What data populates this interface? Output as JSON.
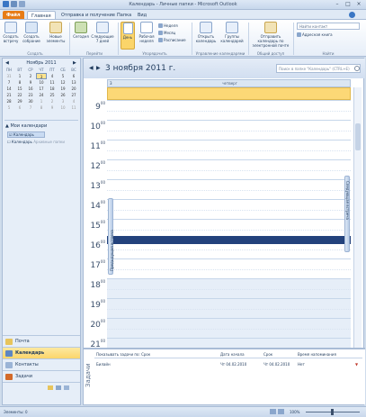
{
  "window": {
    "title": "Календарь - Личные папки - Microsoft Outlook"
  },
  "tabs": [
    "Файл",
    "Главная",
    "Отправка и получение",
    "Папка",
    "Вид"
  ],
  "ribbon": {
    "buttons": {
      "new_meeting_item": "Создать встречу",
      "new_meeting": "Создать собрание",
      "new_items": "Новые элементы",
      "today": "Сегодня",
      "next7": "Следующие 7 дней",
      "day": "День",
      "workweek": "Рабочая неделя",
      "week": "Неделя",
      "month": "Месяц",
      "schedule": "Расписание",
      "open_calendar": "Открыть календарь",
      "calendar_groups": "Группы календарей",
      "send_calendar": "Отправить календарь по электронной почте",
      "find_contact": "Найти контакт",
      "address_book": "Адресная книга"
    },
    "groups": {
      "create": "Создать",
      "goto": "Перейти",
      "arrange": "Упорядочить",
      "manage": "Управление календарями",
      "share": "Общий доступ",
      "find": "Найти"
    }
  },
  "minical": {
    "month": "Ноябрь 2011",
    "weekdays": [
      "ПН",
      "ВТ",
      "СР",
      "ЧТ",
      "ПТ",
      "СБ",
      "ВС"
    ],
    "weeks": [
      [
        "31",
        "1",
        "2",
        "3",
        "4",
        "5",
        "6"
      ],
      [
        "7",
        "8",
        "9",
        "10",
        "11",
        "12",
        "13"
      ],
      [
        "14",
        "15",
        "16",
        "17",
        "18",
        "19",
        "20"
      ],
      [
        "21",
        "22",
        "23",
        "24",
        "25",
        "26",
        "27"
      ],
      [
        "28",
        "29",
        "30",
        "1",
        "2",
        "3",
        "4"
      ],
      [
        "5",
        "6",
        "7",
        "8",
        "9",
        "10",
        "11"
      ]
    ]
  },
  "folders": {
    "header": "Мои календари",
    "item": "Календарь",
    "item2": "Календарь",
    "item2_sub": "Архивные папки"
  },
  "nav": {
    "mail": "Почта",
    "calendar": "Календарь",
    "contacts": "Контакты",
    "tasks": "Задачи"
  },
  "calendar": {
    "date_title": "3 ноября 2011 г.",
    "search_placeholder": "Поиск в папке \"Календарь\" (CTRL+E)",
    "day_number": "3",
    "weekday": "четверг",
    "hours": [
      "9",
      "10",
      "11",
      "12",
      "13",
      "14",
      "15",
      "16",
      "17",
      "18",
      "19",
      "20",
      "21"
    ],
    "minutes": "00",
    "prev_appt": "Предыдущая встреча",
    "next_appt": "Следующая встреча"
  },
  "tasks": {
    "label": "Задачи",
    "headers": [
      "Показывать задачи по: Срок",
      "Дата начала",
      "Срок",
      "Время напоминания"
    ],
    "row": {
      "name": "Билайн",
      "start": "Чт 04.02.2010",
      "due": "Чт 04.02.2010",
      "reminder": "Нет"
    }
  },
  "status": {
    "items": "Элементы: 0",
    "zoom": "100%"
  }
}
